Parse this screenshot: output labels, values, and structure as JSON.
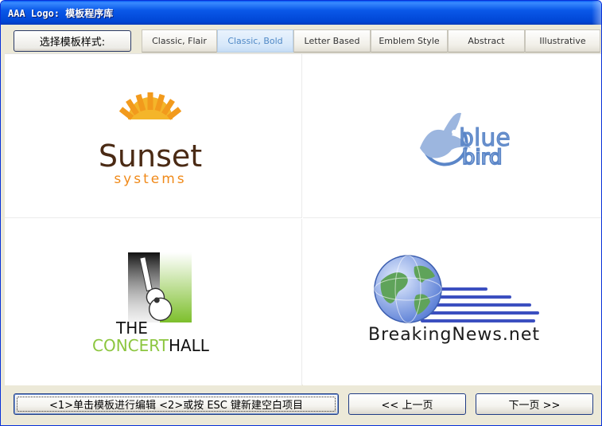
{
  "window": {
    "title": "AAA Logo: 模板程序库"
  },
  "toolbar": {
    "style_label": "选择模板样式:",
    "tabs": [
      {
        "label": "Classic, Flair",
        "active": false
      },
      {
        "label": "Classic, Bold",
        "active": true
      },
      {
        "label": "Letter Based",
        "active": false
      },
      {
        "label": "Emblem Style",
        "active": false
      },
      {
        "label": "Abstract",
        "active": false
      },
      {
        "label": "Illustrative",
        "active": false
      }
    ]
  },
  "templates": [
    {
      "name": "sunset-systems",
      "line1": "Sunset",
      "line2": "systems",
      "icon": "sun-icon",
      "colors": {
        "text": "#4a2a14",
        "accent": "#f29a1c"
      }
    },
    {
      "name": "blue-bird",
      "line1": "blue",
      "line2": "bird",
      "icon": "bird-icon",
      "colors": {
        "text": "#5b86c8"
      }
    },
    {
      "name": "the-concert-hall",
      "line1": "THE",
      "line2_a": "CONCERT",
      "line2_b": "HALL",
      "icon": "guitar-icon",
      "colors": {
        "text": "#111111",
        "accent": "#8cc63f"
      }
    },
    {
      "name": "breaking-news",
      "line1_a": "BreakingNews",
      "line1_b": ".net",
      "icon": "globe-icon",
      "colors": {
        "text": "#1a1a1a",
        "accent": "#3b4fc0"
      }
    }
  ],
  "footer": {
    "hint_label": "<1>单击模板进行编辑  <2>或按 ESC 键新建空白项目",
    "prev_label": "<< 上一页",
    "next_label": "下一页 >>"
  }
}
